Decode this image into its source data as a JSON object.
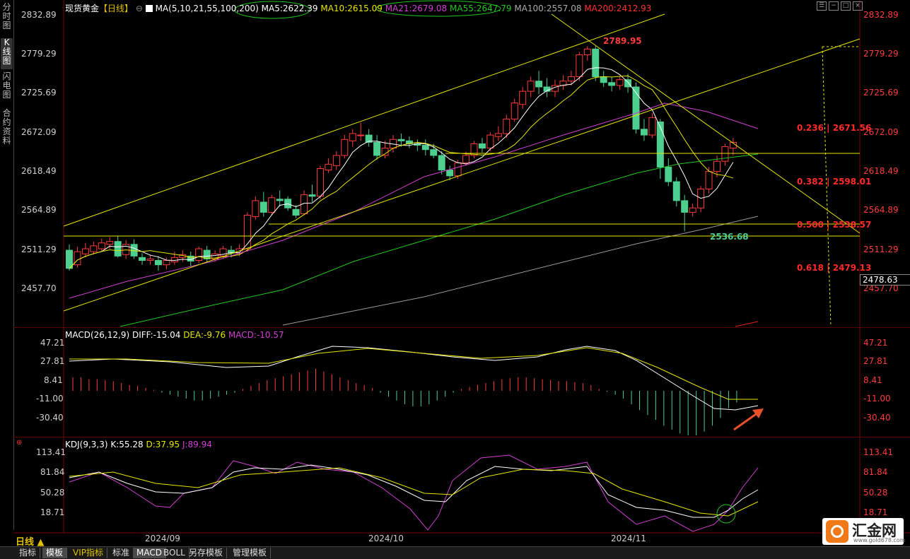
{
  "left_tabs": [
    "分时图",
    "K线图",
    "闪电图",
    "合约资料"
  ],
  "left_tabs_active": 1,
  "main_legend": {
    "symbol": "现货黄金",
    "period": "【日线】",
    "ma_title": "MA(5,10,21,55,100,200)",
    "ma5": "MA5:2622.39",
    "ma10": "MA10:2615.09",
    "ma21": "MA21:2679.08",
    "ma55": "MA55:2647.79",
    "ma100": "MA100:2557.08",
    "ma200": "MA200:2412.93"
  },
  "price_axis": [
    "2832.89",
    "2779.29",
    "2725.69",
    "2672.09",
    "2618.49",
    "2564.89",
    "2511.29",
    "2457.70"
  ],
  "current_price_box": "2478.63",
  "annotations": {
    "high": "2789.95",
    "low": "2536.68",
    "fib": [
      {
        "ratio": "0.236",
        "price": "2671.56"
      },
      {
        "ratio": "0.382",
        "price": "2598.01"
      },
      {
        "ratio": "0.500",
        "price": "2538.57"
      },
      {
        "ratio": "0.618",
        "price": "2479.13"
      }
    ]
  },
  "macd_legend": {
    "title": "MACD(26,12,9)",
    "diff": "DIFF:-15.04",
    "dea": "DEA:-9.76",
    "macd": "MACD:-10.57"
  },
  "macd_axis": [
    "47.21",
    "27.81",
    "8.41",
    "-11.00",
    "-30.40"
  ],
  "kdj_legend": {
    "title": "KDJ(9,3,3)",
    "k": "K:55.28",
    "d": "D:37.95",
    "j": "J:89.94"
  },
  "kdj_axis": [
    "113.41",
    "81.84",
    "50.28",
    "18.71"
  ],
  "dates": [
    "2024/09",
    "2024/10",
    "2024/11"
  ],
  "period_label": "日线 ▲",
  "bottom_tabs": [
    {
      "label": "指标",
      "active": false,
      "vip": false
    },
    {
      "label": "模板",
      "active": true,
      "vip": false
    },
    {
      "label": "VIP指标",
      "active": false,
      "vip": true
    },
    {
      "label": "标准",
      "active": false,
      "vip": false
    },
    {
      "label": "MACD",
      "active": true,
      "vip": false
    },
    {
      "label": "BOLL",
      "active": false,
      "vip": false
    },
    {
      "label": "另存模板",
      "active": false,
      "vip": false
    },
    {
      "label": "管理模板",
      "active": false,
      "vip": false
    }
  ],
  "logo": {
    "name": "汇金网",
    "url": "www.gold678.com"
  },
  "colors": {
    "up": "#ff3b3b",
    "down": "#4ccf8f",
    "ma5": "#ffffff",
    "ma10": "#e6e600",
    "ma21": "#d040d0",
    "ma55": "#22c922",
    "ma100": "#9a9a9a",
    "ma200": "#e02020"
  }
}
